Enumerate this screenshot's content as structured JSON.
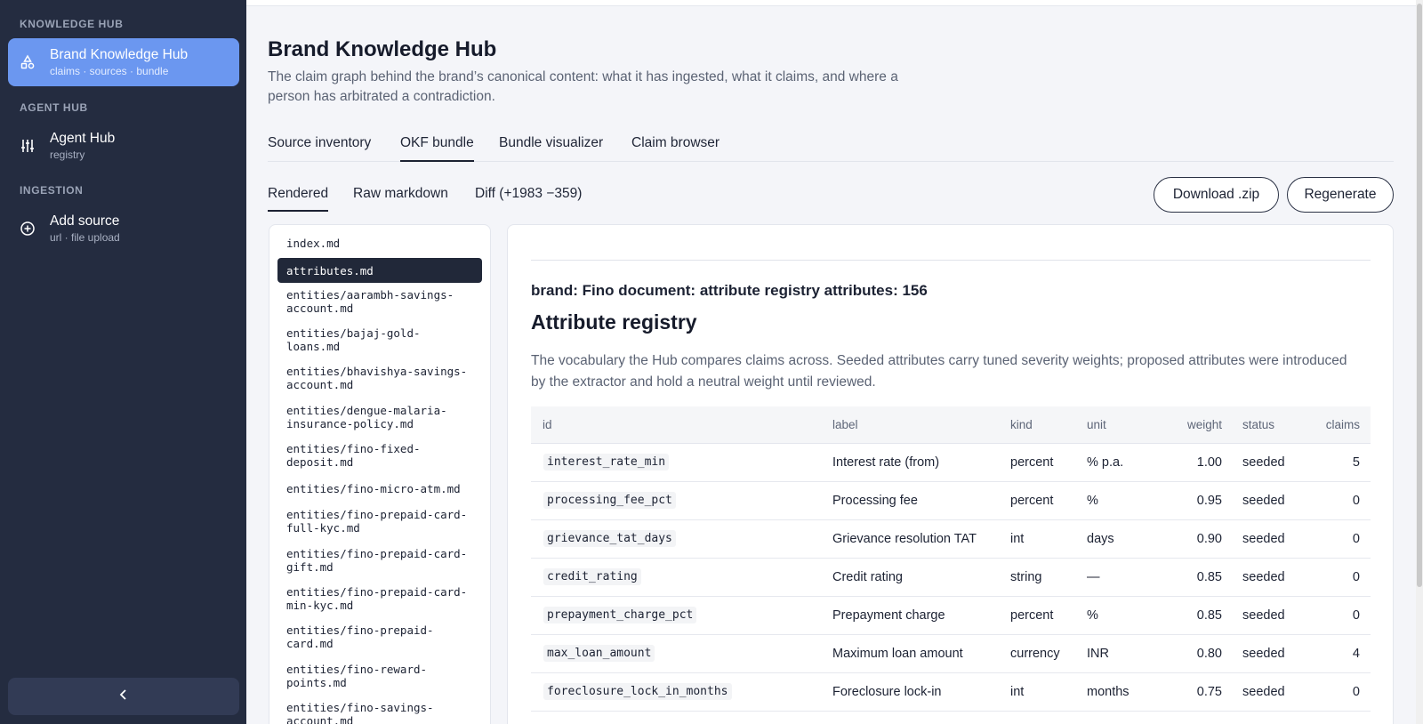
{
  "sidebar": {
    "sections": [
      {
        "label": "KNOWLEDGE HUB"
      },
      {
        "label": "AGENT HUB"
      },
      {
        "label": "INGESTION"
      }
    ],
    "items": [
      {
        "title": "Brand Knowledge Hub",
        "subtitle": "claims · sources · bundle",
        "icon": "shapes-icon"
      },
      {
        "title": "Agent Hub",
        "subtitle": "registry",
        "icon": "sliders-icon"
      },
      {
        "title": "Add source",
        "subtitle": "url · file upload",
        "icon": "plus-circle-icon"
      }
    ],
    "collapse_icon": "chevron-left-icon"
  },
  "header": {
    "title": "Brand Knowledge Hub",
    "description": "The claim graph behind the brand’s canonical content: what it has ingested, what it claims, and where a person has arbitrated a contradiction."
  },
  "tabs": [
    "Source inventory",
    "OKF bundle",
    "Bundle visualizer",
    "Claim browser"
  ],
  "subtabs": [
    "Rendered",
    "Raw markdown",
    "Diff (+1983 −359)"
  ],
  "actions": {
    "download": "Download .zip",
    "regenerate": "Regenerate"
  },
  "files": [
    "index.md",
    "attributes.md",
    "entities/aarambh-savings-\naccount.md",
    "entities/bajaj-gold-\nloans.md",
    "entities/bhavishya-savings-\naccount.md",
    "entities/dengue-malaria-\ninsurance-policy.md",
    "entities/fino-fixed-\ndeposit.md",
    "entities/fino-micro-atm.md",
    "entities/fino-prepaid-card-\nfull-kyc.md",
    "entities/fino-prepaid-card-\ngift.md",
    "entities/fino-prepaid-card-\nmin-kyc.md",
    "entities/fino-prepaid-\ncard.md",
    "entities/fino-reward-\npoints.md",
    "entities/fino-savings-\naccount.md"
  ],
  "document": {
    "meta": "brand: Fino document: attribute registry attributes: 156",
    "title": "Attribute registry",
    "description": "The vocabulary the Hub compares claims across. Seeded attributes carry tuned severity weights; proposed attributes were introduced by the extractor and hold a neutral weight until reviewed."
  },
  "table": {
    "columns": [
      "id",
      "label",
      "kind",
      "unit",
      "weight",
      "status",
      "claims"
    ],
    "rows": [
      {
        "id": "interest_rate_min",
        "label": "Interest rate (from)",
        "kind": "percent",
        "unit": "% p.a.",
        "weight": "1.00",
        "status": "seeded",
        "claims": "5"
      },
      {
        "id": "processing_fee_pct",
        "label": "Processing fee",
        "kind": "percent",
        "unit": "%",
        "weight": "0.95",
        "status": "seeded",
        "claims": "0"
      },
      {
        "id": "grievance_tat_days",
        "label": "Grievance resolution TAT",
        "kind": "int",
        "unit": "days",
        "weight": "0.90",
        "status": "seeded",
        "claims": "0"
      },
      {
        "id": "credit_rating",
        "label": "Credit rating",
        "kind": "string",
        "unit": "—",
        "weight": "0.85",
        "status": "seeded",
        "claims": "0"
      },
      {
        "id": "prepayment_charge_pct",
        "label": "Prepayment charge",
        "kind": "percent",
        "unit": "%",
        "weight": "0.85",
        "status": "seeded",
        "claims": "0"
      },
      {
        "id": "max_loan_amount",
        "label": "Maximum loan amount",
        "kind": "currency",
        "unit": "INR",
        "weight": "0.80",
        "status": "seeded",
        "claims": "4"
      },
      {
        "id": "foreclosure_lock_in_months",
        "label": "Foreclosure lock-in",
        "kind": "int",
        "unit": "months",
        "weight": "0.75",
        "status": "seeded",
        "claims": "0"
      }
    ]
  }
}
